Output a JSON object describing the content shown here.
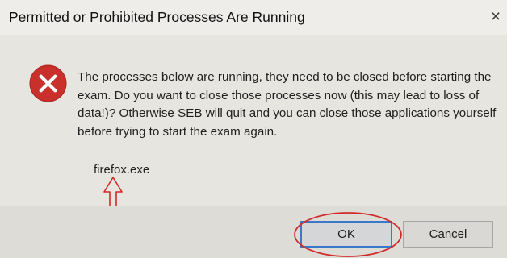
{
  "window": {
    "title": "Permitted or Prohibited Processes Are Running",
    "close_glyph": "×"
  },
  "dialog": {
    "icon": "error-icon",
    "message": "The processes below are running, they need to be closed before starting the exam. Do you want to close those processes now (this may lead to loss of data!)? Otherwise SEB will quit and you can close those applications yourself before trying to start the exam again.",
    "processes": [
      "firefox.exe"
    ]
  },
  "buttons": {
    "ok_label": "OK",
    "cancel_label": "Cancel"
  },
  "annotations": {
    "color": "#d22a2a",
    "arrow": "up-arrow",
    "highlight": "ellipse around OK button"
  },
  "colors": {
    "error_red": "#c9302c",
    "focus_blue": "#3a78c9"
  }
}
